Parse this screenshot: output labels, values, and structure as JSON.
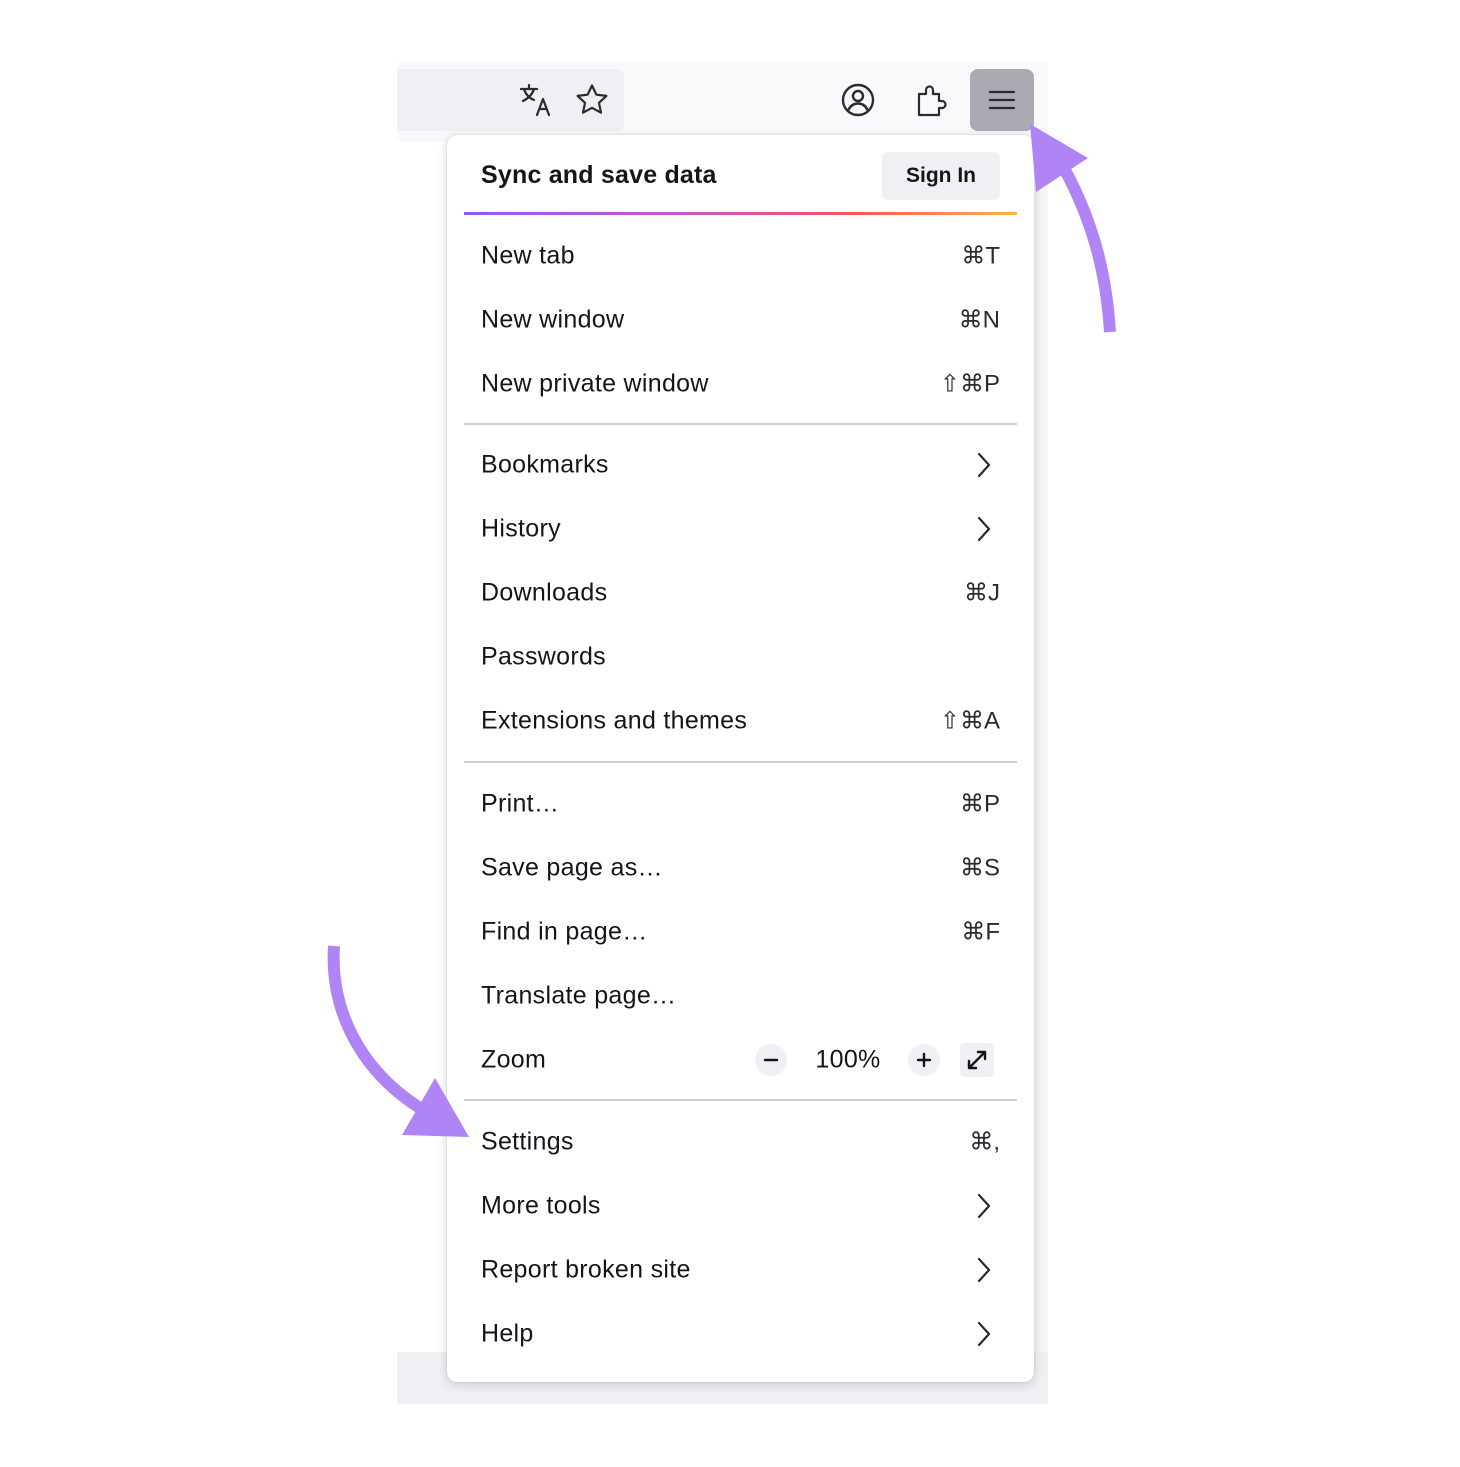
{
  "colors": {
    "accent_arrow": "#b084f5",
    "menu_button_active": "#abaab3",
    "separator": "#cfcfd8",
    "text": "#15141a"
  },
  "toolbar": {
    "icons": [
      "translate-icon",
      "bookmark-star-icon",
      "account-icon",
      "extensions-icon",
      "hamburger-menu-icon"
    ]
  },
  "menu": {
    "sync": {
      "title": "Sync and save data",
      "sign_in_label": "Sign In"
    },
    "group1": [
      {
        "label": "New tab",
        "shortcut": "⌘T"
      },
      {
        "label": "New window",
        "shortcut": "⌘N"
      },
      {
        "label": "New private window",
        "shortcut": "⇧⌘P"
      }
    ],
    "group2": [
      {
        "label": "Bookmarks",
        "submenu": true
      },
      {
        "label": "History",
        "submenu": true
      },
      {
        "label": "Downloads",
        "shortcut": "⌘J"
      },
      {
        "label": "Passwords"
      },
      {
        "label": "Extensions and themes",
        "shortcut": "⇧⌘A"
      }
    ],
    "group3": [
      {
        "label": "Print…",
        "shortcut": "⌘P"
      },
      {
        "label": "Save page as…",
        "shortcut": "⌘S"
      },
      {
        "label": "Find in page…",
        "shortcut": "⌘F"
      },
      {
        "label": "Translate page…"
      }
    ],
    "zoom": {
      "label": "Zoom",
      "value": "100%",
      "minus": "−",
      "plus": "+"
    },
    "group4": [
      {
        "label": "Settings",
        "shortcut": "⌘,"
      },
      {
        "label": "More tools",
        "submenu": true
      },
      {
        "label": "Report broken site",
        "submenu": true
      },
      {
        "label": "Help",
        "submenu": true
      }
    ]
  }
}
